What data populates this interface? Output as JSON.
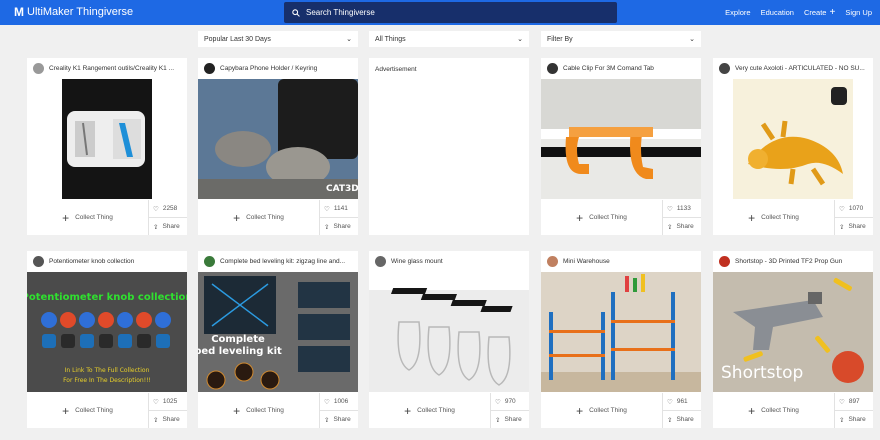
{
  "header": {
    "brand": "UltiMaker Thingiverse",
    "search_placeholder": "Search Thingiverse",
    "nav": [
      "Explore",
      "Education",
      "Create",
      "Sign Up"
    ]
  },
  "filters": [
    "Popular Last 30 Days",
    "All Things",
    "Filter By"
  ],
  "ad_label": "Advertisement",
  "collect_label": "Collect Thing",
  "share_label": "Share",
  "cards": [
    {
      "title": "Creality K1 Rangement outils/Creality K1 ...",
      "likes": "2258"
    },
    {
      "title": "Capybara Phone Holder / Keyring",
      "likes": "1141"
    },
    {
      "title": "Cable Clip For 3M Comand Tab",
      "likes": "1133"
    },
    {
      "title": "Very cute Axoloti - ARTICULATED - NO SU...",
      "likes": "1070"
    },
    {
      "title": "Potentiometer knob collection",
      "likes": "1025"
    },
    {
      "title": "Complete bed leveling kit: zigzag line and...",
      "likes": "1006"
    },
    {
      "title": "Wine glass mount",
      "likes": "970"
    },
    {
      "title": "Mini Warehouse",
      "likes": "961"
    },
    {
      "title": "Shortstop - 3D Printed TF2 Prop Gun",
      "likes": "897"
    }
  ],
  "images": {
    "knob_title": "Potentiometer knob collection",
    "knob_caption_1": "In Link To The Full Collection",
    "knob_caption_2": "For Free In The Description!!!",
    "bed_caption_1": "Complete",
    "bed_caption_2": "bed leveling kit",
    "capy_tag": "CAT3D",
    "shortstop_text": "Shortstop"
  }
}
